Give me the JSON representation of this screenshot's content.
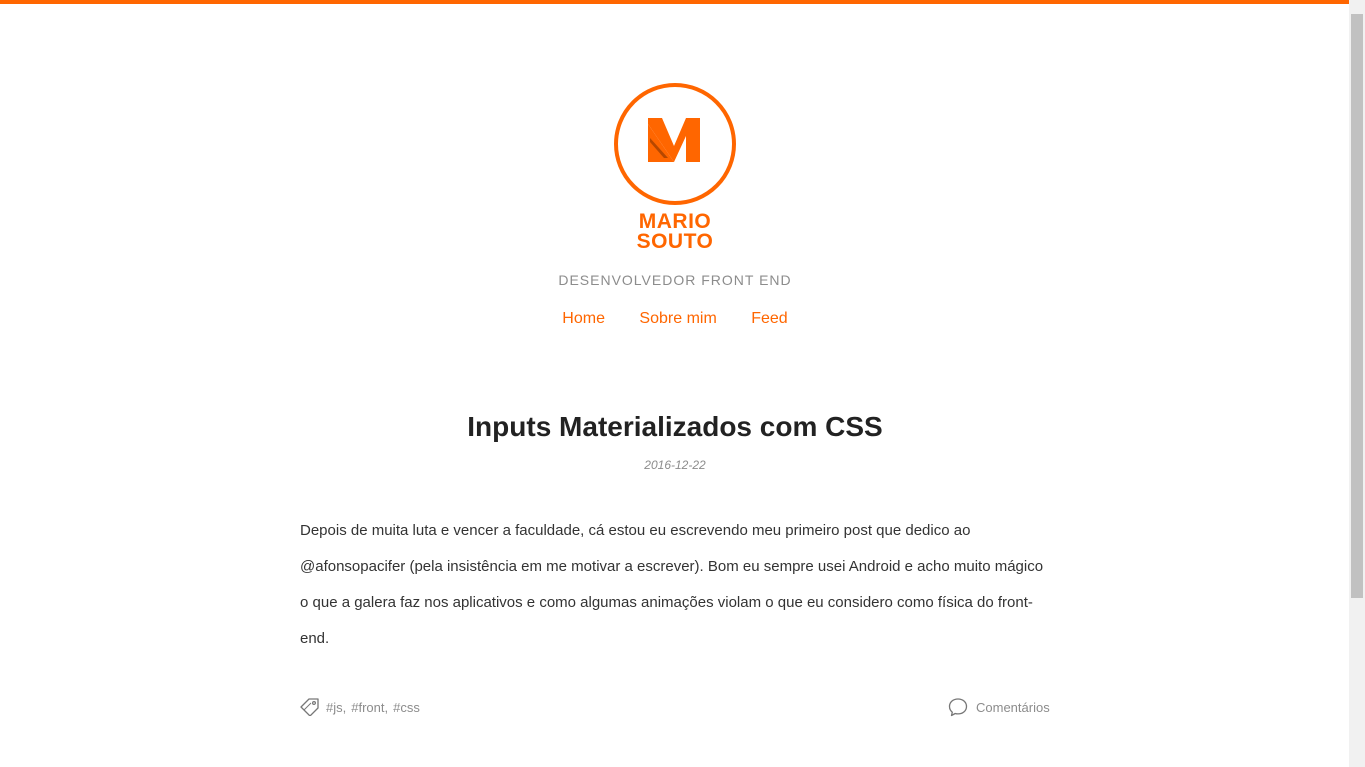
{
  "colors": {
    "accent": "#ff6600",
    "title_text": "#222222",
    "body_text": "#333333",
    "muted_text": "#8c8c8c"
  },
  "header": {
    "logo_line1": "MARIO",
    "logo_line2": "SOUTO",
    "subtitle": "DESENVOLVEDOR FRONT END",
    "nav": {
      "home": "Home",
      "about": "Sobre mim",
      "feed": "Feed"
    }
  },
  "post": {
    "title": "Inputs Materializados com CSS",
    "date": "2016-12-22",
    "excerpt": "Depois de muita luta e vencer a faculdade, cá estou eu escrevendo meu primeiro post que dedico ao @afonsopacifer (pela insistência em me motivar a escrever). Bom eu sempre usei Android e acho muito mágico o que a galera faz nos aplicativos e como algumas animações violam o que eu considero como física do front-end.",
    "tags": [
      "#js",
      "#front",
      "#css"
    ],
    "comments_label": "Comentários"
  },
  "icons": {
    "logo": "m-logo-icon",
    "tags": "tag-icon",
    "comments": "speech-bubble-icon"
  }
}
